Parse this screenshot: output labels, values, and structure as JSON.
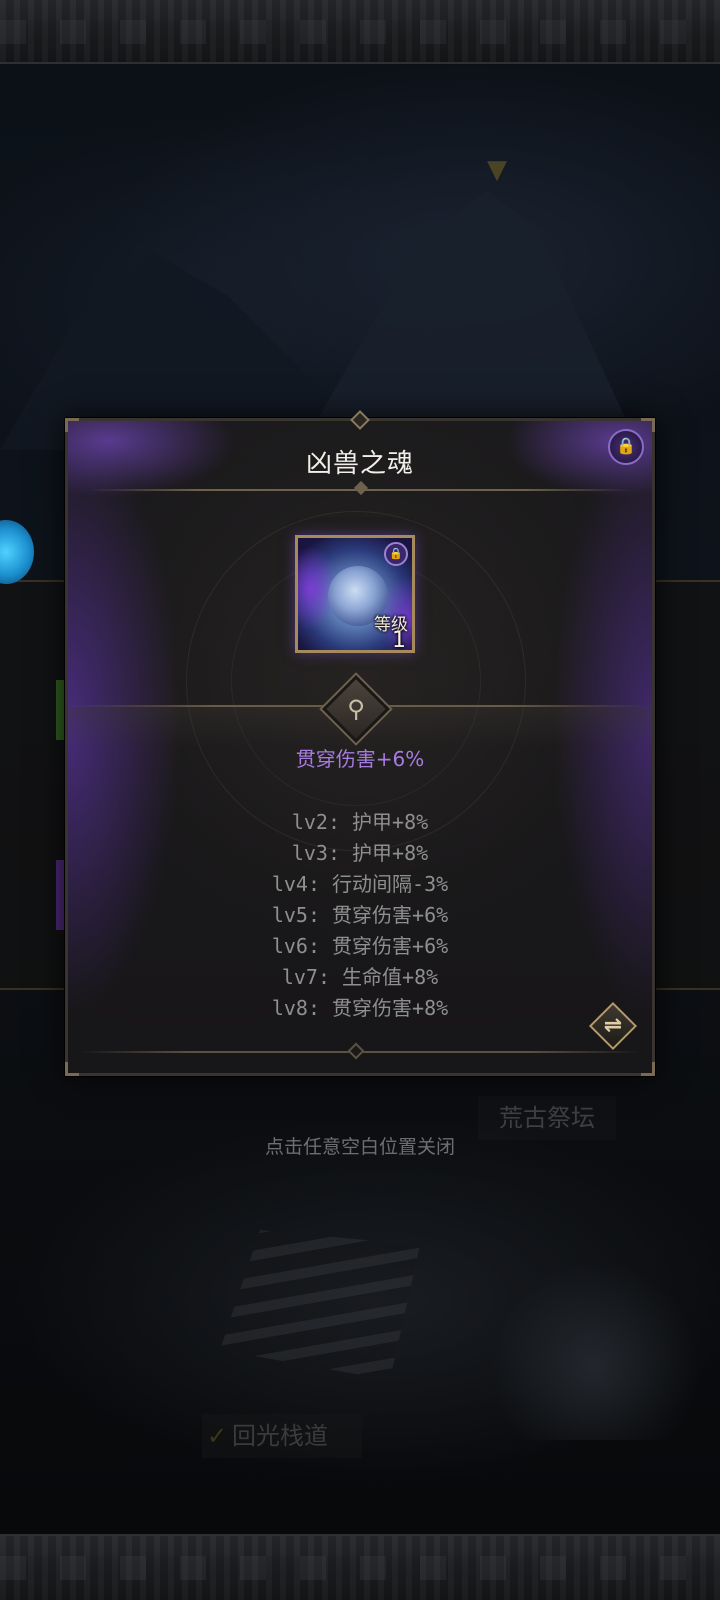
{
  "background": {
    "altar_label": "荒古祭坛",
    "close_hint": "点击任意空白位置关闭",
    "path_label": "回光栈道"
  },
  "modal": {
    "title": "凶兽之魂",
    "item": {
      "level_label": "等级",
      "level_value": "1",
      "rarity_color": "#6a3fc0"
    },
    "main_effect": "贯穿伤害+6%",
    "main_effect_color": "#a77be0",
    "level_effects": [
      {
        "level": "lv2",
        "effect": "护甲+8%"
      },
      {
        "level": "lv3",
        "effect": "护甲+8%"
      },
      {
        "level": "lv4",
        "effect": "行动间隔-3%"
      },
      {
        "level": "lv5",
        "effect": "贯穿伤害+6%"
      },
      {
        "level": "lv6",
        "effect": "贯穿伤害+6%"
      },
      {
        "level": "lv7",
        "effect": "生命值+8%"
      },
      {
        "level": "lv8",
        "effect": "贯穿伤害+8%"
      }
    ],
    "icons": {
      "lock": "lock-icon",
      "search": "magnifier-icon",
      "swap": "swap-icon"
    }
  }
}
